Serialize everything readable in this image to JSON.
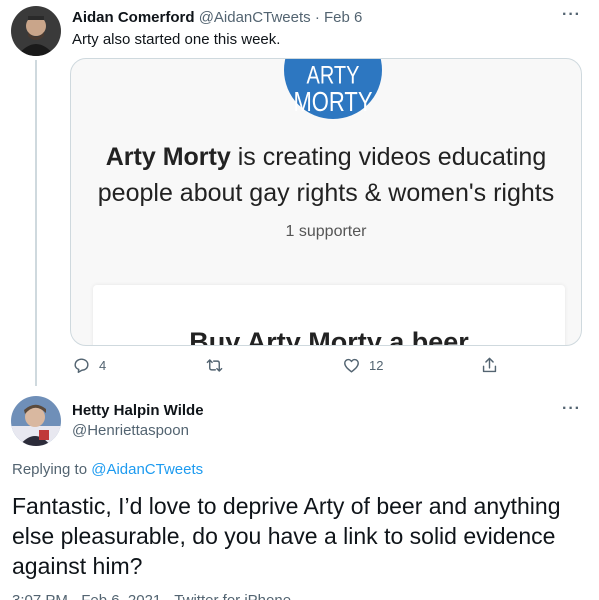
{
  "tweet1": {
    "author_name": "Aidan Comerford",
    "handle": "@AidanCTweets",
    "separator": "·",
    "date": "Feb 6",
    "text": "Arty also started one this week.",
    "more": "···",
    "card": {
      "logo_line1": "ARTY",
      "logo_line2": "MORTY",
      "headline_name": "Arty Morty",
      "headline_rest": " is creating videos educating people about gay rights & women's rights",
      "supporters": "1 supporter",
      "cta": "Buy Arty Morty a beer"
    },
    "actions": {
      "replies": "4",
      "retweets": "",
      "likes": "12"
    }
  },
  "tweet2": {
    "author_name": "Hetty Halpin Wilde",
    "handle": "@Henriettaspoon",
    "more": "···",
    "replying_prefix": "Replying to ",
    "replying_mention": "@AidanCTweets",
    "text": "Fantastic, I’d love to deprive Arty of beer and anything else pleasurable, do you have a link to solid evidence against him?",
    "meta": "3:07 PM · Feb 6, 2021 · Twitter for iPhone"
  },
  "colors": {
    "link": "#1d9bf0",
    "secondary_text": "#536471",
    "logo_blue": "#2d77c1"
  }
}
